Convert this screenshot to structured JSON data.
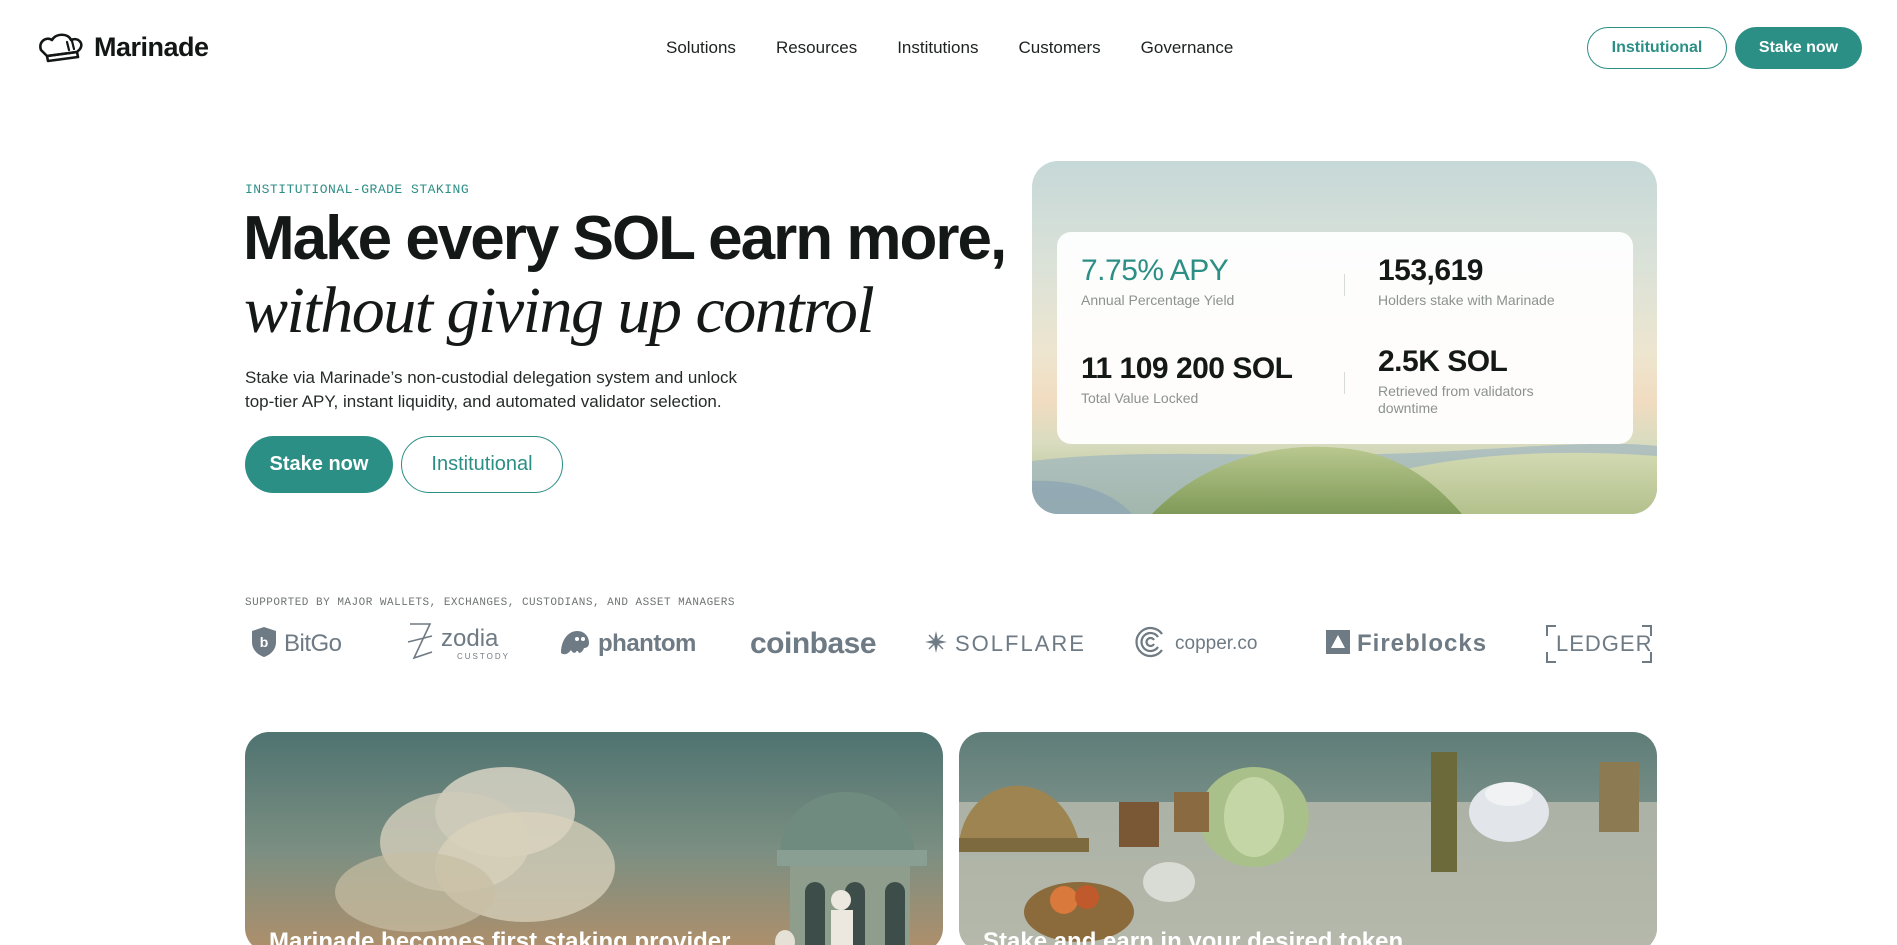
{
  "brand": {
    "name": "Marinade",
    "logo_icon": "chef-hat-icon"
  },
  "nav": {
    "items": [
      {
        "label": "Solutions"
      },
      {
        "label": "Resources"
      },
      {
        "label": "Institutions"
      },
      {
        "label": "Customers"
      },
      {
        "label": "Governance"
      }
    ]
  },
  "header_buttons": {
    "institutional": "Institutional",
    "stake_now": "Stake now"
  },
  "hero": {
    "eyebrow": "INSTITUTIONAL-GRADE STAKING",
    "title_line1": "Make every SOL earn more,",
    "title_line2": "without giving up control",
    "description": "Stake via Marinade’s non-custodial delegation system and unlock top-tier APY, instant liquidity, and automated validator selection.",
    "stake_button": "Stake now",
    "institutional_button": "Institutional"
  },
  "stats": [
    {
      "value": "7.75% APY",
      "label": "Annual Percentage Yield"
    },
    {
      "value": "153,619",
      "label": "Holders stake with Marinade"
    },
    {
      "value": "11 109 200 SOL",
      "label": "Total Value Locked"
    },
    {
      "value": "2.5K SOL",
      "label": "Retrieved from validators downtime"
    }
  ],
  "partners": {
    "label": "SUPPORTED BY MAJOR WALLETS, EXCHANGES, CUSTODIANS, AND ASSET MANAGERS",
    "logos": [
      {
        "name": "BitGo",
        "icon": "shield-icon"
      },
      {
        "name": "zodia",
        "sub": "CUSTODY",
        "icon": "zodia-star-icon"
      },
      {
        "name": "phantom",
        "icon": "phantom-ghost-icon"
      },
      {
        "name": "coinbase"
      },
      {
        "name": "SOLFLARE",
        "icon": "solflare-star-icon"
      },
      {
        "name": "copper.co",
        "icon": "copper-c-icon"
      },
      {
        "name": "Fireblocks",
        "icon": "fireblocks-square-icon"
      },
      {
        "name": "LEDGER",
        "icon": "ledger-frame-icon"
      }
    ]
  },
  "cards": [
    {
      "title": "Marinade becomes first staking provider"
    },
    {
      "title": "Stake and earn in your desired token"
    }
  ],
  "colors": {
    "accent": "#2c8f85",
    "text": "#141817",
    "muted": "#8c9290",
    "logo_gray": "#6e7a84"
  }
}
